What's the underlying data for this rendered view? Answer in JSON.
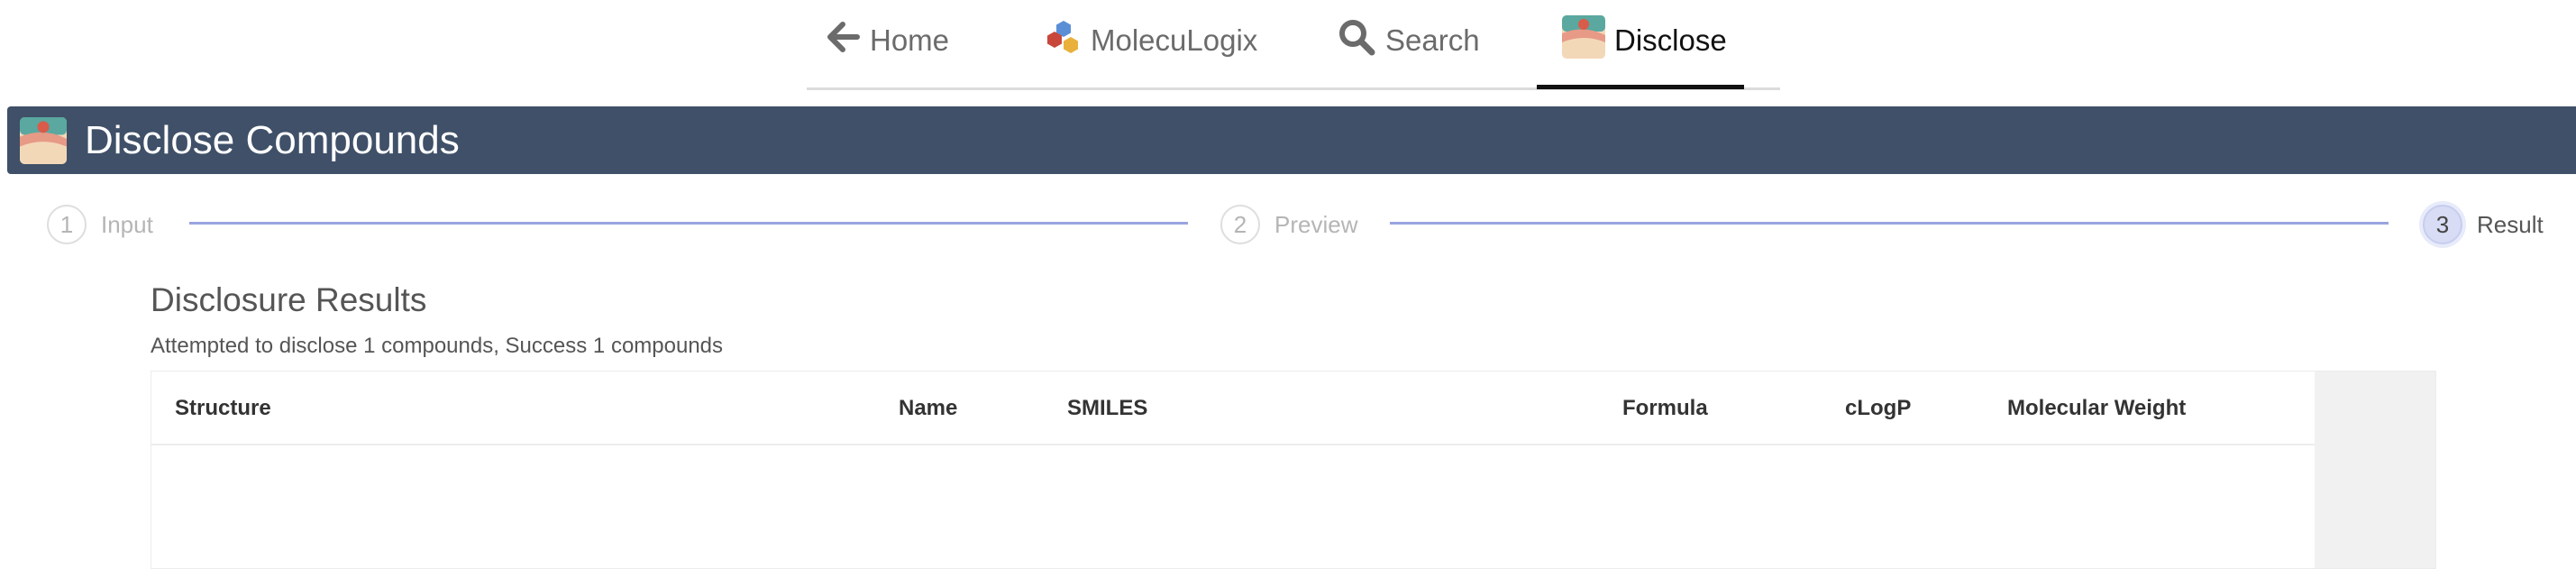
{
  "nav": {
    "items": [
      {
        "label": "Home",
        "icon": "arrow-left-icon"
      },
      {
        "label": "MolecuLogix",
        "icon": "molecule-icon"
      },
      {
        "label": "Search",
        "icon": "search-icon"
      },
      {
        "label": "Disclose",
        "icon": "disclose-icon",
        "active": true
      }
    ]
  },
  "header": {
    "title": "Disclose Compounds",
    "color": "#3f5068"
  },
  "stepper": {
    "steps": [
      {
        "number": "1",
        "label": "Input"
      },
      {
        "number": "2",
        "label": "Preview"
      },
      {
        "number": "3",
        "label": "Result",
        "current": true
      }
    ],
    "line_color": "#9aa4e0"
  },
  "results": {
    "title": "Disclosure Results",
    "summary": "Attempted to disclose 1 compounds, Success 1 compounds",
    "columns": [
      "Structure",
      "Name",
      "SMILES",
      "Formula",
      "cLogP",
      "Molecular Weight"
    ]
  }
}
